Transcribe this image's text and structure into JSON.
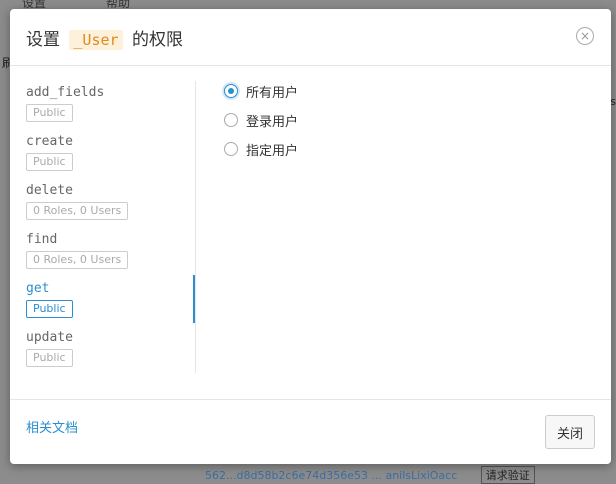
{
  "background": {
    "top_items": [
      "设置",
      "帮助"
    ],
    "left_fragment": "刷",
    "right_fragment": "s",
    "bottom_text": "562...d8d58b2c6e74d356e53 ... anilsLixiOacc",
    "bottom_button": "请求验证"
  },
  "dialog": {
    "title_prefix": "设置",
    "title_class": "_User",
    "title_suffix": "的权限",
    "close_icon": "×"
  },
  "permissions": [
    {
      "name": "add_fields",
      "badge": "Public",
      "active": false
    },
    {
      "name": "create",
      "badge": "Public",
      "active": false
    },
    {
      "name": "delete",
      "badge": "0 Roles, 0 Users",
      "active": false
    },
    {
      "name": "find",
      "badge": "0 Roles, 0 Users",
      "active": false
    },
    {
      "name": "get",
      "badge": "Public",
      "active": true
    },
    {
      "name": "update",
      "badge": "Public",
      "active": false
    }
  ],
  "options": [
    {
      "label": "所有用户",
      "checked": true
    },
    {
      "label": "登录用户",
      "checked": false
    },
    {
      "label": "指定用户",
      "checked": false
    }
  ],
  "footer": {
    "docs_link": "相关文档",
    "close_button": "关闭"
  },
  "colors": {
    "accent": "#2a8ed1",
    "title_code_text": "#e08a1e",
    "title_code_bg": "#fdf1dc"
  }
}
